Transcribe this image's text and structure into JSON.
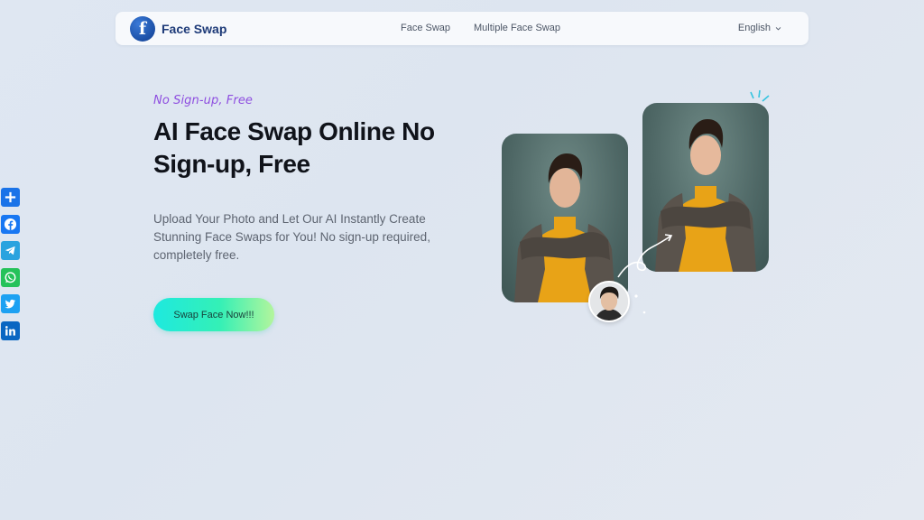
{
  "nav": {
    "brand_initial": "f",
    "brand": "Face Swap",
    "links": [
      "Face Swap",
      "Multiple Face Swap"
    ],
    "language": "English"
  },
  "hero": {
    "tagline": "No Sign-up, Free",
    "headline": "AI Face Swap Online No Sign-up, Free",
    "subtext": "Upload Your Photo and Let Our AI Instantly Create Stunning Face Swaps for You! No sign-up required, completely free.",
    "cta": "Swap Face Now!!!"
  },
  "share": [
    {
      "name": "share",
      "color": "#1a73e8"
    },
    {
      "name": "facebook",
      "color": "#1877f2"
    },
    {
      "name": "telegram",
      "color": "#2aa3df"
    },
    {
      "name": "whatsapp",
      "color": "#25c25a"
    },
    {
      "name": "twitter",
      "color": "#1da1f2"
    },
    {
      "name": "linkedin",
      "color": "#0a66c2"
    }
  ],
  "colors": {
    "accent_purple": "#8e4ee0",
    "brand_blue": "#1d3a78",
    "cta_gradient_start": "#1ee9df",
    "cta_gradient_end": "#b3f59c"
  },
  "images": {
    "left_photo": "man-yellow-sweater-photo",
    "right_photo": "man-yellow-sweater-swapped-photo",
    "face_source": "face-source-avatar"
  }
}
